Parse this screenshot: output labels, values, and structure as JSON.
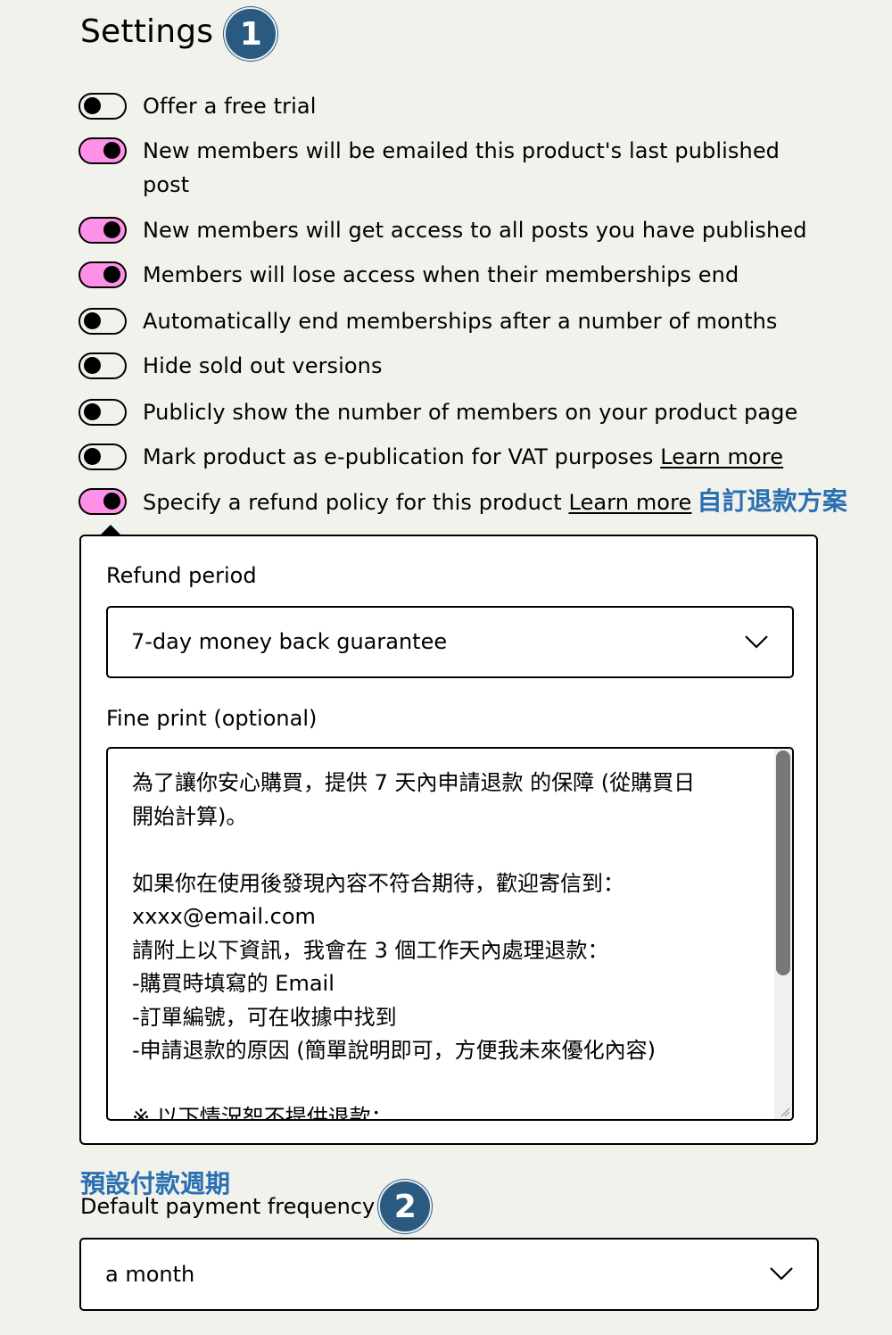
{
  "header": {
    "title": "Settings",
    "badge": "1"
  },
  "toggles": [
    {
      "label": "Offer a free trial",
      "on": false
    },
    {
      "label": "New members will be emailed this product's last published",
      "label_line2": "post",
      "on": true
    },
    {
      "label": "New members will get access to all posts you have published",
      "on": true
    },
    {
      "label": "Members will lose access when their memberships end",
      "on": true
    },
    {
      "label": "Automatically end memberships after a number of months",
      "on": false
    },
    {
      "label": "Hide sold out versions",
      "on": false
    },
    {
      "label": "Publicly show the number of members on your product page",
      "on": false
    },
    {
      "label": "Mark product as e-publication for VAT purposes",
      "link": "Learn more",
      "on": false
    },
    {
      "label": "Specify a refund policy for this product",
      "link": "Learn more",
      "annotation": "自訂退款方案",
      "on": true
    }
  ],
  "refund": {
    "period_label": "Refund period",
    "period_value": "7-day money back guarantee",
    "fine_print_label": "Fine print (optional)",
    "fine_print_lines": [
      "為了讓你安心購買，提供 7 天內申請退款 的保障 (從購買日",
      "開始計算)。",
      "",
      "如果你在使用後發現內容不符合期待，歡迎寄信到：",
      "xxxx@email.com",
      "請附上以下資訊，我會在 3 個工作天內處理退款：",
      "-購買時填寫的 Email",
      "-訂單編號，可在收據中找到",
      "-申請退款的原因 (簡單說明即可，方便我未來優化內容)",
      "",
      "※ 以下情況恕不提供退款："
    ]
  },
  "payment": {
    "annotation": "預設付款週期",
    "label": "Default payment frequency",
    "badge": "2",
    "value": "a month"
  },
  "colors": {
    "toggle_on": "#ff90e8",
    "annotation": "#2a6fb0",
    "badge": "#2b5a80",
    "background": "#f2f2ed"
  }
}
